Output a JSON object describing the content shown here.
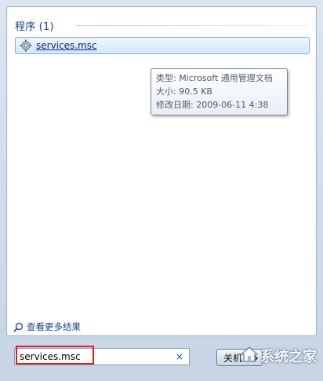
{
  "programs_section": {
    "title": "程序 (1)"
  },
  "results": [
    {
      "label": "services.msc",
      "icon": "gear-icon"
    }
  ],
  "tooltip": {
    "type_line": "类型: Microsoft 通用管理文档",
    "size_line": "大小: 90.5 KB",
    "date_line": "修改日期: 2009-06-11 4:38"
  },
  "more_results": {
    "label": "查看更多结果",
    "icon": "search-icon"
  },
  "search": {
    "value": "services.msc",
    "clear_glyph": "×"
  },
  "shutdown": {
    "label": "关机",
    "icon": "chevron-right-icon"
  },
  "watermark": {
    "text": "系统之家"
  },
  "colors": {
    "accent": "#1e3e8a",
    "highlight": "#e02020",
    "selection": "#d4e6fb"
  }
}
